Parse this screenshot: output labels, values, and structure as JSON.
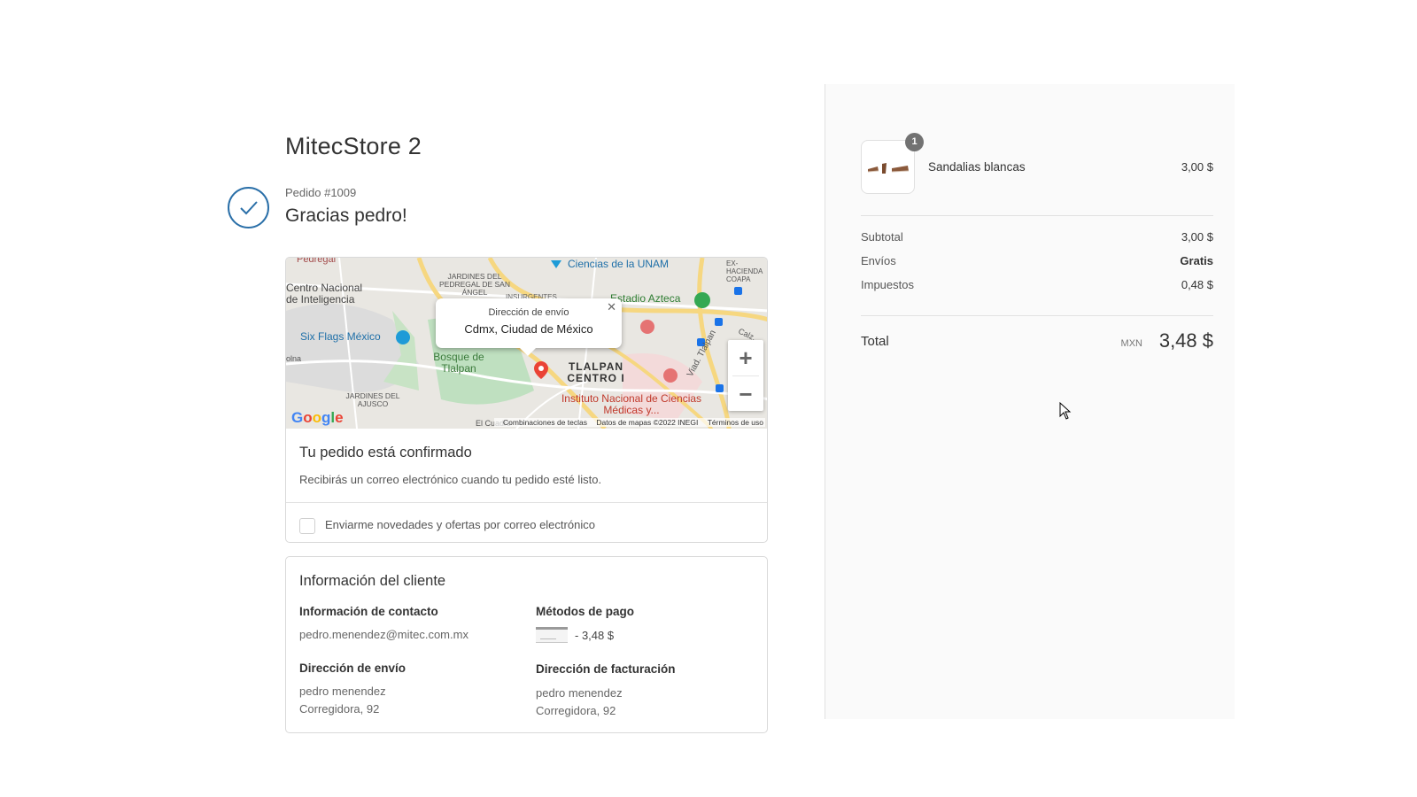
{
  "store": {
    "name": "MitecStore 2"
  },
  "order": {
    "number": "Pedido #1009",
    "thanks": "Gracias pedro!"
  },
  "map": {
    "popup_title": "Dirección de envío",
    "popup_city": "Cdmx, Ciudad de México",
    "labels": {
      "pedregal": "Pedregal",
      "ciencias": "Ciencias de la UNAM",
      "jardines_pedregal": "JARDINES DEL PEDREGAL DE SAN ÁNGEL",
      "insurgentes": "INSURGENTES",
      "ex_hacienda": "EX-HACIENDA COAPA",
      "centro_nacional": "Centro Nacional de Inteligencia",
      "estadio": "Estadio Azteca",
      "six_flags": "Six Flags México",
      "bosque": "Bosque de Tlalpan",
      "tlalpan": "TLALPAN CENTRO I",
      "instituto": "Instituto Nacional de Ciencias Médicas y...",
      "jardines_ajusco": "JARDINES DEL AJUSCO",
      "viaducto": "Viad. Tlalpan",
      "calz": "Calz.",
      "olna": "olna",
      "el_cuadro": "El Cuadro"
    },
    "footer_shortcuts": "Combinaciones de teclas",
    "footer_data": "Datos de mapas ©2022 INEGI",
    "footer_terms": "Términos de uso",
    "zoom_in": "+",
    "zoom_out": "−"
  },
  "confirmation": {
    "title": "Tu pedido está confirmado",
    "text": "Recibirás un correo electrónico cuando tu pedido esté listo.",
    "newsletter_label": "Enviarme novedades y ofertas por correo electrónico"
  },
  "customer": {
    "title": "Información del cliente",
    "contact_heading": "Información de contacto",
    "contact_email": "pedro.menendez@mitec.com.mx",
    "payment_heading": "Métodos de pago",
    "payment_amount": "- 3,48 $",
    "shipping_heading": "Dirección de envío",
    "shipping_name": "pedro menendez",
    "shipping_street": "Corregidora, 92",
    "billing_heading": "Dirección de facturación",
    "billing_name": "pedro menendez",
    "billing_street": "Corregidora, 92"
  },
  "summary": {
    "product": {
      "quantity": "1",
      "name": "Sandalias blancas",
      "price": "3,00 $"
    },
    "subtotal_label": "Subtotal",
    "subtotal_value": "3,00 $",
    "shipping_label": "Envíos",
    "shipping_value": "Gratis",
    "taxes_label": "Impuestos",
    "taxes_value": "0,48 $",
    "total_label": "Total",
    "total_currency": "MXN",
    "total_value": "3,48 $"
  },
  "colors": {
    "accent": "#2a6fa8",
    "sidebar_bg": "#fafafa",
    "border": "#d9d9d9"
  }
}
